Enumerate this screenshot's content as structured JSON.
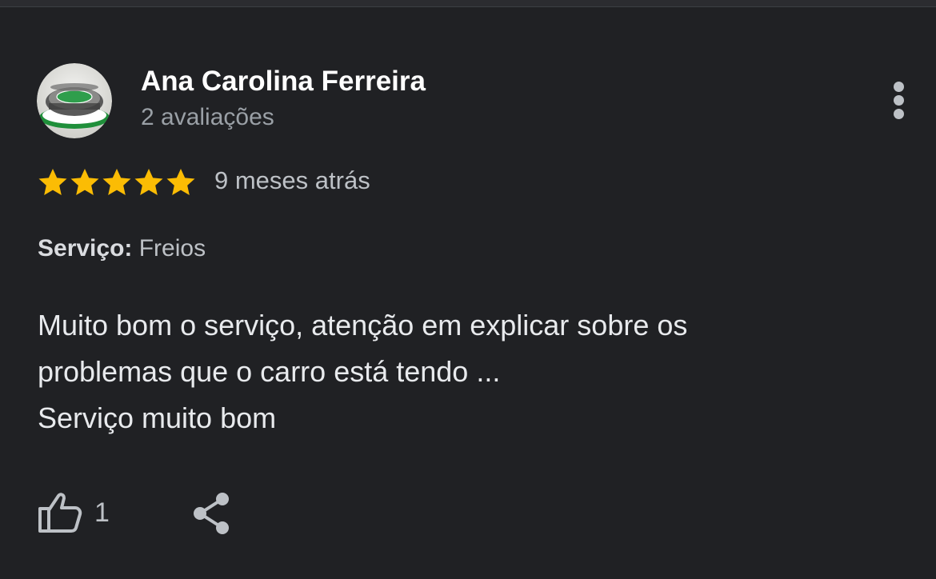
{
  "reviewer": {
    "name": "Ana Carolina Ferreira",
    "review_count": "2 avaliações",
    "avatar_icon": "stadium-avatar"
  },
  "review": {
    "rating": 5,
    "max_rating": 5,
    "date": "9 meses atrás",
    "service_label": "Serviço:",
    "service_value": "Freios",
    "text_lines": [
      "Muito bom o serviço, atenção em explicar sobre os",
      "problemas que o carro está tendo ...",
      "Serviço muito bom"
    ]
  },
  "actions": {
    "like_count": "1",
    "like_icon": "thumbs-up-icon",
    "share_icon": "share-icon",
    "more_icon": "more-vert-icon"
  },
  "colors": {
    "background": "#202124",
    "star": "#fbbc04",
    "primary_text": "#e8eaed",
    "secondary_text": "#9aa0a6"
  }
}
